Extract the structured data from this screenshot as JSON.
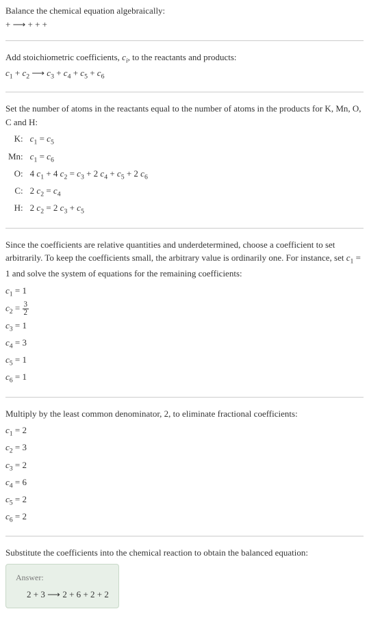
{
  "s1": {
    "line1": "Balance the chemical equation algebraically:",
    "line2_a": " + ",
    "line2_arrow": "⟶",
    "line2_b": " + + + "
  },
  "s2": {
    "line1_a": "Add stoichiometric coefficients, ",
    "line1_ci": "c",
    "line1_i": "i",
    "line1_b": ", to the reactants and products:",
    "eq_c1": "c",
    "eq_1": "1",
    "eq_plus1": " + ",
    "eq_c2": "c",
    "eq_2": "2",
    "eq_sp1": " ",
    "eq_arrow": "⟶",
    "eq_sp2": " ",
    "eq_c3": "c",
    "eq_3": "3",
    "eq_plus2": " + ",
    "eq_c4": "c",
    "eq_4": "4",
    "eq_plus3": " + ",
    "eq_c5": "c",
    "eq_5": "5",
    "eq_plus4": " + ",
    "eq_c6": "c",
    "eq_6": "6"
  },
  "s3": {
    "intro": "Set the number of atoms in the reactants equal to the number of atoms in the products for K, Mn, O, C and H:",
    "rows": [
      {
        "el": "K:",
        "lhs_a": "c",
        "lhs_as": "1",
        "mid": " = ",
        "rhs_a": "c",
        "rhs_as": "5"
      },
      {
        "el": "Mn:",
        "lhs_a": "c",
        "lhs_as": "1",
        "mid": " = ",
        "rhs_a": "c",
        "rhs_as": "6"
      }
    ],
    "rowO": {
      "el": "O:",
      "t1": "4 ",
      "c1": "c",
      "s1": "1",
      "t2": " + 4 ",
      "c2": "c",
      "s2": "2",
      "t3": " = ",
      "c3": "c",
      "s3": "3",
      "t4": " + 2 ",
      "c4": "c",
      "s4": "4",
      "t5": " + ",
      "c5": "c",
      "s5": "5",
      "t6": " + 2 ",
      "c6": "c",
      "s6": "6"
    },
    "rowC": {
      "el": "C:",
      "t1": "2 ",
      "c1": "c",
      "s1": "2",
      "t2": " = ",
      "c2": "c",
      "s2": "4"
    },
    "rowH": {
      "el": "H:",
      "t1": "2 ",
      "c1": "c",
      "s1": "2",
      "t2": " = 2 ",
      "c2": "c",
      "s2": "3",
      "t3": " + ",
      "c3": "c",
      "s3": "5"
    }
  },
  "s4": {
    "intro_a": "Since the coefficients are relative quantities and underdetermined, choose a coefficient to set arbitrarily. To keep the coefficients small, the arbitrary value is ordinarily one. For instance, set ",
    "intro_c": "c",
    "intro_s": "1",
    "intro_b": " = 1 and solve the system of equations for the remaining coefficients:",
    "c1l": "c",
    "c1s": "1",
    "c1v": " = 1",
    "c2l": "c",
    "c2s": "2",
    "c2eq": " = ",
    "c2num": "3",
    "c2den": "2",
    "c3l": "c",
    "c3s": "3",
    "c3v": " = 1",
    "c4l": "c",
    "c4s": "4",
    "c4v": " = 3",
    "c5l": "c",
    "c5s": "5",
    "c5v": " = 1",
    "c6l": "c",
    "c6s": "6",
    "c6v": " = 1"
  },
  "s5": {
    "intro": "Multiply by the least common denominator, 2, to eliminate fractional coefficients:",
    "c1l": "c",
    "c1s": "1",
    "c1v": " = 2",
    "c2l": "c",
    "c2s": "2",
    "c2v": " = 3",
    "c3l": "c",
    "c3s": "3",
    "c3v": " = 2",
    "c4l": "c",
    "c4s": "4",
    "c4v": " = 6",
    "c5l": "c",
    "c5s": "5",
    "c5v": " = 2",
    "c6l": "c",
    "c6s": "6",
    "c6v": " = 2"
  },
  "s6": {
    "intro": "Substitute the coefficients into the chemical reaction to obtain the balanced equation:",
    "answer_label": "Answer:",
    "eq_a": "2 ",
    "eq_b": " + 3 ",
    "eq_arrow": " ⟶ ",
    "eq_c": "2 ",
    "eq_d": " + 6 ",
    "eq_e": " + 2 ",
    "eq_f": " + 2"
  }
}
